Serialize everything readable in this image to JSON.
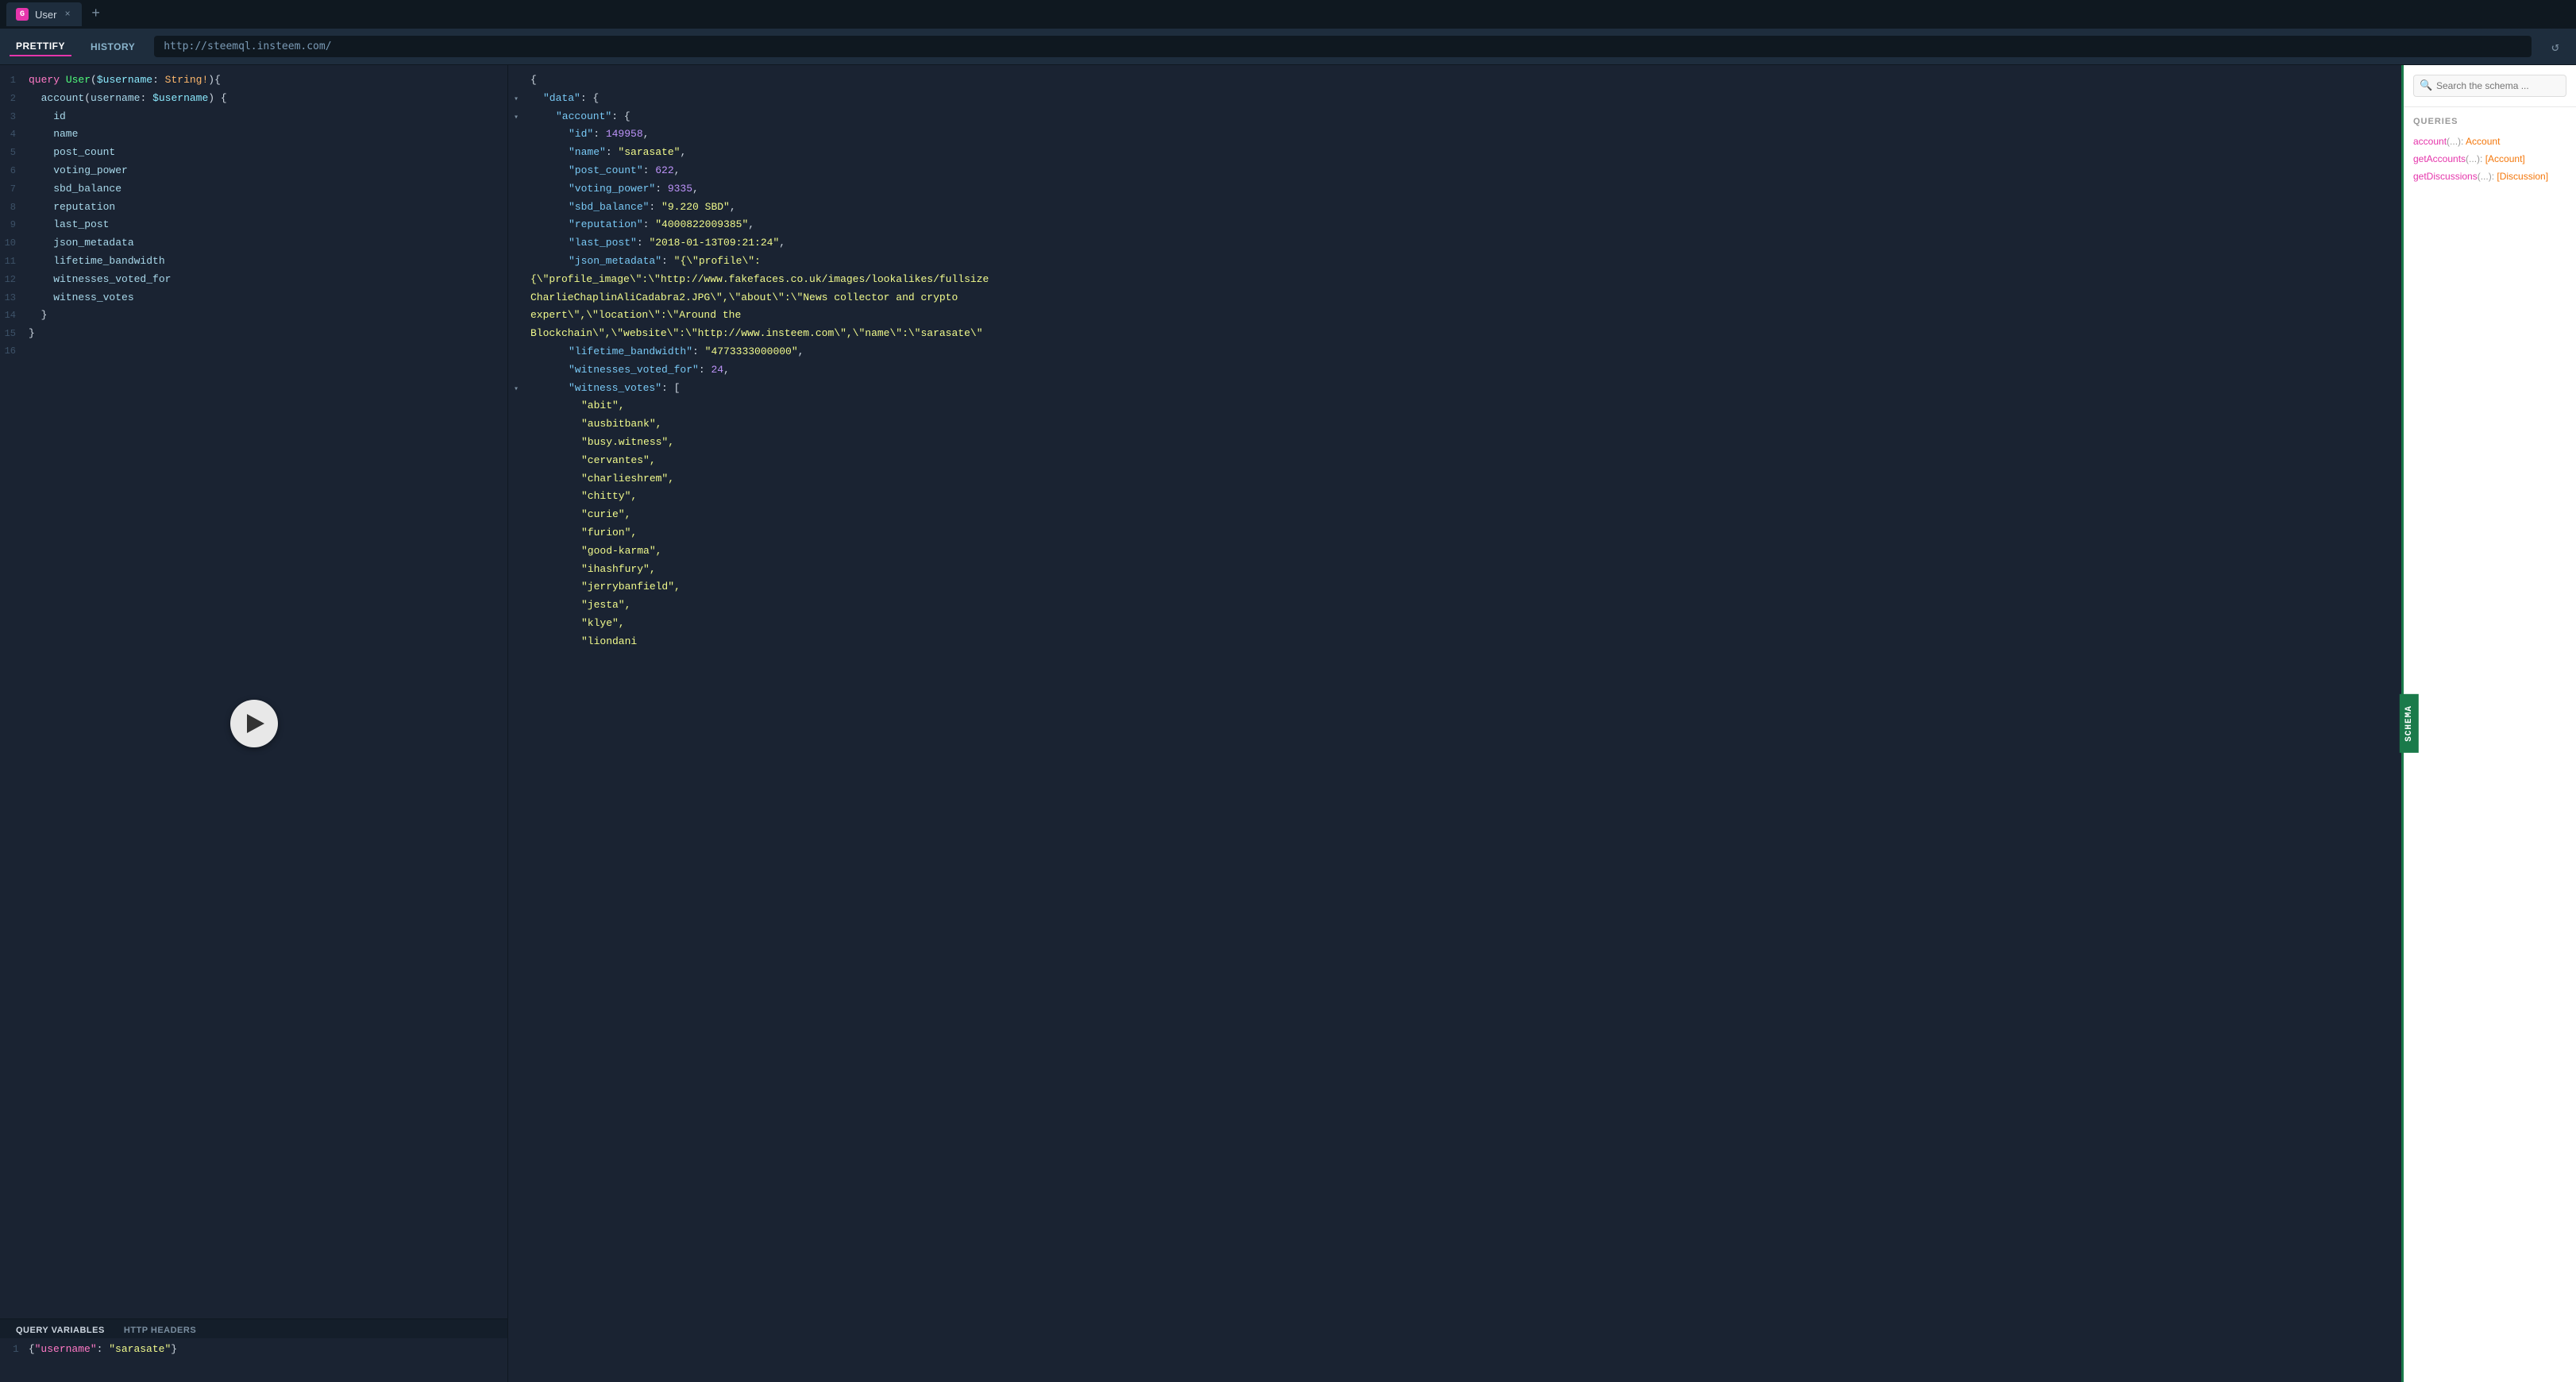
{
  "tab": {
    "logo": "G",
    "label": "User",
    "close": "×"
  },
  "toolbar": {
    "prettify_label": "PRETTIFY",
    "history_label": "HISTORY",
    "url": "http://steemql.insteem.com/",
    "refresh_icon": "↺"
  },
  "editor": {
    "lines": [
      {
        "num": 1,
        "tokens": [
          {
            "text": "query ",
            "cls": "c-keyword"
          },
          {
            "text": "User",
            "cls": "c-fn"
          },
          {
            "text": "(",
            "cls": "c-punct"
          },
          {
            "text": "$username",
            "cls": "c-var"
          },
          {
            "text": ": ",
            "cls": "c-punct"
          },
          {
            "text": "String!",
            "cls": "c-type"
          },
          {
            "text": "){",
            "cls": "c-punct"
          }
        ]
      },
      {
        "num": 2,
        "tokens": [
          {
            "text": "  account",
            "cls": "c-field"
          },
          {
            "text": "(",
            "cls": "c-punct"
          },
          {
            "text": "username",
            "cls": "c-field"
          },
          {
            "text": ": ",
            "cls": "c-punct"
          },
          {
            "text": "$username",
            "cls": "c-var"
          },
          {
            "text": ") {",
            "cls": "c-punct"
          }
        ]
      },
      {
        "num": 3,
        "tokens": [
          {
            "text": "    id",
            "cls": "c-field"
          }
        ]
      },
      {
        "num": 4,
        "tokens": [
          {
            "text": "    name",
            "cls": "c-field"
          }
        ]
      },
      {
        "num": 5,
        "tokens": [
          {
            "text": "    post_count",
            "cls": "c-field"
          }
        ]
      },
      {
        "num": 6,
        "tokens": [
          {
            "text": "    voting_power",
            "cls": "c-field"
          }
        ]
      },
      {
        "num": 7,
        "tokens": [
          {
            "text": "    sbd_balance",
            "cls": "c-field"
          }
        ]
      },
      {
        "num": 8,
        "tokens": [
          {
            "text": "    reputation",
            "cls": "c-field"
          }
        ]
      },
      {
        "num": 9,
        "tokens": [
          {
            "text": "    last_post",
            "cls": "c-field"
          }
        ]
      },
      {
        "num": 10,
        "tokens": [
          {
            "text": "    json_metadata",
            "cls": "c-field"
          }
        ]
      },
      {
        "num": 11,
        "tokens": [
          {
            "text": "    lifetime_bandwidth",
            "cls": "c-field"
          }
        ]
      },
      {
        "num": 12,
        "tokens": [
          {
            "text": "    witnesses_voted_for",
            "cls": "c-field"
          }
        ]
      },
      {
        "num": 13,
        "tokens": [
          {
            "text": "    witness_votes",
            "cls": "c-field"
          }
        ]
      },
      {
        "num": 14,
        "tokens": [
          {
            "text": "  }",
            "cls": "c-punct"
          }
        ]
      },
      {
        "num": 15,
        "tokens": [
          {
            "text": "}",
            "cls": "c-punct"
          }
        ]
      },
      {
        "num": 16,
        "tokens": []
      }
    ]
  },
  "query_vars": {
    "tab1_label": "QUERY VARIABLES",
    "tab2_label": "HTTP HEADERS",
    "value": "{\"username\": \"sarasate\"}"
  },
  "result": {
    "lines": [
      {
        "indent": "r-indent-0",
        "arrow": false,
        "content": "{",
        "cls": "r-punct"
      },
      {
        "indent": "r-indent-1",
        "arrow": true,
        "content": "\"data\": {",
        "key": "\"data\"",
        "colon": ": ",
        "rest": "{",
        "keycls": "r-key"
      },
      {
        "indent": "r-indent-2",
        "arrow": true,
        "content": "\"account\": {",
        "key": "\"account\"",
        "colon": ": ",
        "rest": "{",
        "keycls": "r-key"
      },
      {
        "indent": "r-indent-3",
        "arrow": false,
        "content": "\"id\": 149958,",
        "key": "\"id\"",
        "colon": ": ",
        "val": "149958",
        "valcls": "r-number",
        "trail": ","
      },
      {
        "indent": "r-indent-3",
        "arrow": false,
        "content": "\"name\": \"sarasate\",",
        "key": "\"name\"",
        "colon": ": ",
        "val": "\"sarasate\"",
        "valcls": "r-string",
        "trail": ","
      },
      {
        "indent": "r-indent-3",
        "arrow": false,
        "content": "\"post_count\": 622,",
        "key": "\"post_count\"",
        "colon": ": ",
        "val": "622",
        "valcls": "r-number",
        "trail": ","
      },
      {
        "indent": "r-indent-3",
        "arrow": false,
        "content": "\"voting_power\": 9335,",
        "key": "\"voting_power\"",
        "colon": ": ",
        "val": "9335",
        "valcls": "r-number",
        "trail": ","
      },
      {
        "indent": "r-indent-3",
        "arrow": false,
        "content": "\"sbd_balance\": \"9.220 SBD\",",
        "key": "\"sbd_balance\"",
        "colon": ": ",
        "val": "\"9.220 SBD\"",
        "valcls": "r-string",
        "trail": ","
      },
      {
        "indent": "r-indent-3",
        "arrow": false,
        "content": "\"reputation\": \"4000822009385\",",
        "key": "\"reputation\"",
        "colon": ": ",
        "val": "\"4000822009385\"",
        "valcls": "r-string",
        "trail": ","
      },
      {
        "indent": "r-indent-3",
        "arrow": false,
        "content": "\"last_post\": \"2018-01-13T09:21:24\",",
        "key": "\"last_post\"",
        "colon": ": ",
        "val": "\"2018-01-13T09:21:24\"",
        "valcls": "r-string",
        "trail": ","
      },
      {
        "indent": "r-indent-3",
        "arrow": false,
        "content": "\"json_metadata\": \"{\\\"profile\\\":",
        "key": "\"json_metadata\"",
        "colon": ": ",
        "val": "\"{\\\"profile\\\":",
        "valcls": "r-string",
        "trail": ""
      },
      {
        "indent": "r-indent-0",
        "arrow": false,
        "content": "{\\\"profile_image\\\":\\\"http://www.fakefaces.co.uk/images/lookalikes/fullsize",
        "cls": "r-string"
      },
      {
        "indent": "r-indent-0",
        "arrow": false,
        "content": "CharlieChaplinAliCadabra2.JPG\\\",\\\"about\\\":\\\"News collector and crypto",
        "cls": "r-string"
      },
      {
        "indent": "r-indent-0",
        "arrow": false,
        "content": "expert\\\",\\\"location\\\":\\\"Around the",
        "cls": "r-string"
      },
      {
        "indent": "r-indent-0",
        "arrow": false,
        "content": "Blockchain\\\",\\\"website\\\":\\\"http://www.insteem.com\\\",\\\"name\\\":\\\"sarasate\\\"",
        "cls": "r-string"
      },
      {
        "indent": "r-indent-3",
        "arrow": false,
        "content": "\"lifetime_bandwidth\": \"4773333000000\",",
        "key": "\"lifetime_bandwidth\"",
        "colon": ": ",
        "val": "\"4773333000000\"",
        "valcls": "r-string",
        "trail": ","
      },
      {
        "indent": "r-indent-3",
        "arrow": false,
        "content": "\"witnesses_voted_for\": 24,",
        "key": "\"witnesses_voted_for\"",
        "colon": ": ",
        "val": "24",
        "valcls": "r-number",
        "trail": ","
      },
      {
        "indent": "r-indent-3",
        "arrow": true,
        "content": "\"witness_votes\": [",
        "key": "\"witness_votes\"",
        "colon": ": ",
        "rest": "[",
        "keycls": "r-key"
      },
      {
        "indent": "r-indent-4",
        "arrow": false,
        "content": "\"abit\",",
        "cls": "r-string"
      },
      {
        "indent": "r-indent-4",
        "arrow": false,
        "content": "\"ausbitbank\",",
        "cls": "r-string"
      },
      {
        "indent": "r-indent-4",
        "arrow": false,
        "content": "\"busy.witness\",",
        "cls": "r-string"
      },
      {
        "indent": "r-indent-4",
        "arrow": false,
        "content": "\"cervantes\",",
        "cls": "r-string"
      },
      {
        "indent": "r-indent-4",
        "arrow": false,
        "content": "\"charlieshrem\",",
        "cls": "r-string"
      },
      {
        "indent": "r-indent-4",
        "arrow": false,
        "content": "\"chitty\",",
        "cls": "r-string"
      },
      {
        "indent": "r-indent-4",
        "arrow": false,
        "content": "\"curie\",",
        "cls": "r-string"
      },
      {
        "indent": "r-indent-4",
        "arrow": false,
        "content": "\"furion\",",
        "cls": "r-string"
      },
      {
        "indent": "r-indent-4",
        "arrow": false,
        "content": "\"good-karma\",",
        "cls": "r-string"
      },
      {
        "indent": "r-indent-4",
        "arrow": false,
        "content": "\"ihashfury\",",
        "cls": "r-string"
      },
      {
        "indent": "r-indent-4",
        "arrow": false,
        "content": "\"jerrybanfield\",",
        "cls": "r-string"
      },
      {
        "indent": "r-indent-4",
        "arrow": false,
        "content": "\"jesta\",",
        "cls": "r-string"
      },
      {
        "indent": "r-indent-4",
        "arrow": false,
        "content": "\"klye\",",
        "cls": "r-string"
      },
      {
        "indent": "r-indent-4",
        "arrow": false,
        "content": "\"liondani",
        "cls": "r-string"
      }
    ]
  },
  "schema": {
    "search_placeholder": "Search the schema ...",
    "section_title": "QUERIES",
    "schema_tab_label": "SCHEMA",
    "items": [
      {
        "name": "account",
        "args": "(...)",
        "colon": ": ",
        "type": "Account"
      },
      {
        "name": "getAccounts",
        "args": "(...)",
        "colon": ": ",
        "type": "[Account]"
      },
      {
        "name": "getDiscussions",
        "args": "(...)",
        "colon": ": ",
        "type": "[Discussion]"
      }
    ]
  }
}
